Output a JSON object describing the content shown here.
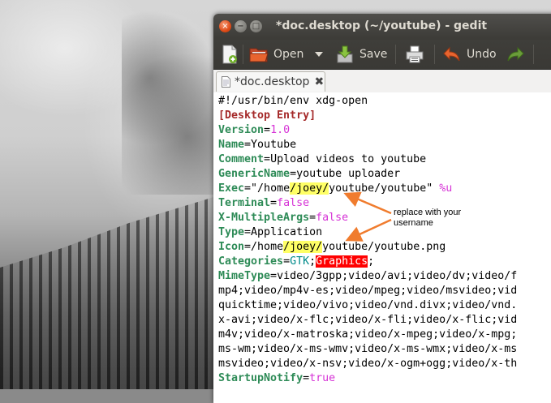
{
  "window": {
    "title": "*doc.desktop (~/youtube) - gedit",
    "controls": {
      "close": "×",
      "minimize": "−",
      "maximize": "□"
    }
  },
  "toolbar": {
    "open_label": "Open",
    "save_label": "Save",
    "undo_label": "Undo",
    "icons": [
      "new-document-icon",
      "open-folder-icon",
      "save-icon",
      "print-icon",
      "undo-icon",
      "redo-icon"
    ]
  },
  "tab": {
    "label": "*doc.desktop",
    "close": "✖"
  },
  "document": {
    "lines": [
      "#!/usr/bin/env xdg-open",
      "[Desktop Entry]",
      "Version=1.0",
      "Name=Youtube",
      "Comment=Upload videos to youtube",
      "GenericName=youtube uploader",
      "Exec=\"/home/joey/youtube/youtube\" %u",
      "Terminal=false",
      "X-MultipleArgs=false",
      "Type=Application",
      "Icon=/home/joey/youtube/youtube.png",
      "Categories=GTK;Graphics;",
      "MimeType=video/3gpp;video/avi;video/dv;video/f",
      "mp4;video/mp4v-es;video/mpeg;video/msvideo;vid",
      "quicktime;video/vivo;video/vnd.divx;video/vnd.",
      "x-avi;video/x-flc;video/x-fli;video/x-flic;vid",
      "m4v;video/x-matroska;video/x-mpeg;video/x-mpg;",
      "ms-wm;video/x-ms-wmv;video/x-ms-wmx;video/x-ms",
      "msvideo;video/x-nsv;video/x-ogm+ogg;video/x-th",
      "StartupNotify=true"
    ],
    "parts": {
      "shebang": "#!/usr/bin/env xdg-open",
      "section": "[Desktop Entry]",
      "version_key": "Version",
      "version_val": "1.0",
      "name_key": "Name",
      "name_val": "Youtube",
      "comment_key": "Comment",
      "comment_val": "Upload videos to youtube",
      "generic_key": "GenericName",
      "generic_val": "youtube uploader",
      "exec_key": "Exec",
      "exec_a": "\"/home",
      "exec_user": "/joey/",
      "exec_b": "youtube/youtube\" ",
      "exec_arg": "%u",
      "terminal_key": "Terminal",
      "terminal_val": "false",
      "multi_key": "X-MultipleArgs",
      "multi_val": "false",
      "type_key": "Type",
      "type_val": "Application",
      "icon_key": "Icon",
      "icon_a": "/home",
      "icon_user": "/joey/",
      "icon_b": "youtube/youtube.png",
      "cat_key": "Categories",
      "cat_gtk": "GTK",
      "cat_sep1": ";",
      "cat_graphics": "Graphics",
      "cat_sep2": ";",
      "mime_key": "MimeType",
      "mime_val": "video/3gpp;video/avi;video/dv;video/f",
      "mime_2": "mp4;video/mp4v-es;video/mpeg;video/msvideo;vid",
      "mime_3": "quicktime;video/vivo;video/vnd.divx;video/vnd.",
      "mime_4": "x-avi;video/x-flc;video/x-fli;video/x-flic;vid",
      "mime_5": "m4v;video/x-matroska;video/x-mpeg;video/x-mpg;",
      "mime_6": "ms-wm;video/x-ms-wmv;video/x-ms-wmx;video/x-ms",
      "mime_7": "msvideo;video/x-nsv;video/x-ogm+ogg;video/x-th",
      "startup_key": "StartupNotify",
      "startup_val": "true"
    }
  },
  "annotation": {
    "line1": "replace with your",
    "line2": "username"
  },
  "colors": {
    "key": "#2e8b57",
    "section": "#a52a2a",
    "value": "#d633d6",
    "highlight": "#ffff66",
    "error": "#ff0000",
    "arrow": "#f07c2e"
  }
}
